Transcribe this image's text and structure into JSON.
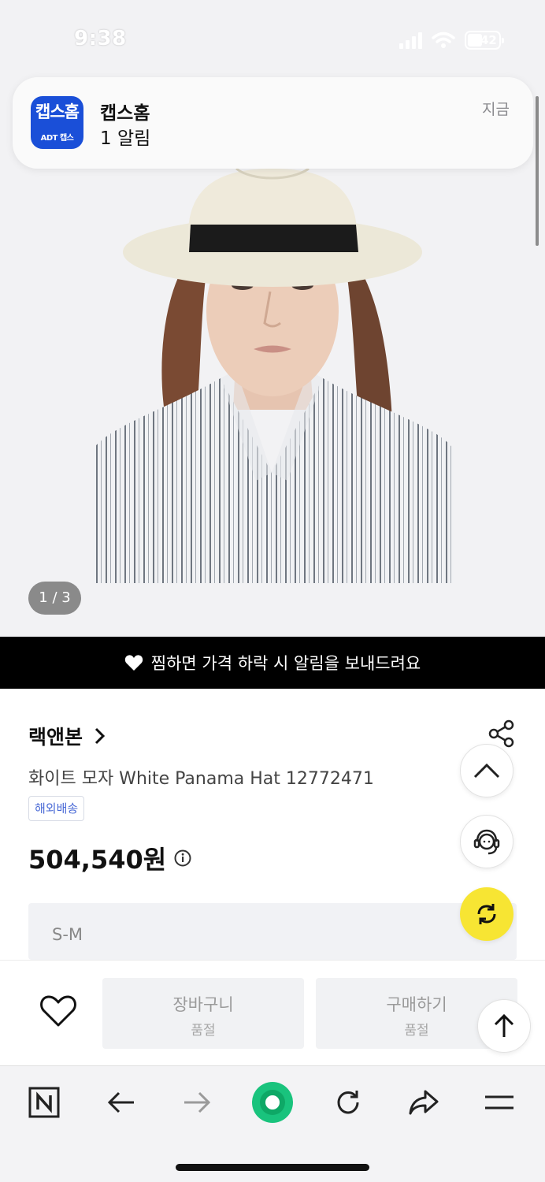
{
  "status_bar": {
    "time": "9:38",
    "battery": "42"
  },
  "notification": {
    "app_icon_text": "캡스홈",
    "app_icon_subtext": "ADT 캡스",
    "title": "캡스홈",
    "body": "1 알림",
    "time": "지금"
  },
  "gallery": {
    "counter": "1 / 3"
  },
  "wish_banner": {
    "text": "찜하면 가격 하락 시 알림을 보내드려요"
  },
  "product": {
    "brand": "랙앤본",
    "name": "화이트 모자 White Panama Hat 12772471",
    "shipping_badge": "해외배송",
    "price": "504,540원"
  },
  "option": {
    "selected": "S-M"
  },
  "purchase_bar": {
    "cart_label": "장바구니",
    "cart_status": "품절",
    "buy_label": "구매하기",
    "buy_status": "품절"
  },
  "browser_toolbar": {
    "items": [
      "naver-home",
      "back",
      "forward",
      "green-dot",
      "reload",
      "share",
      "menu"
    ]
  },
  "colors": {
    "banner_bg": "#000000",
    "refresh_fab": "#f7e533",
    "naver_green": "#19c37d",
    "notif_icon_bg": "#1a4fd8",
    "badge_text": "#4a6ad6"
  }
}
